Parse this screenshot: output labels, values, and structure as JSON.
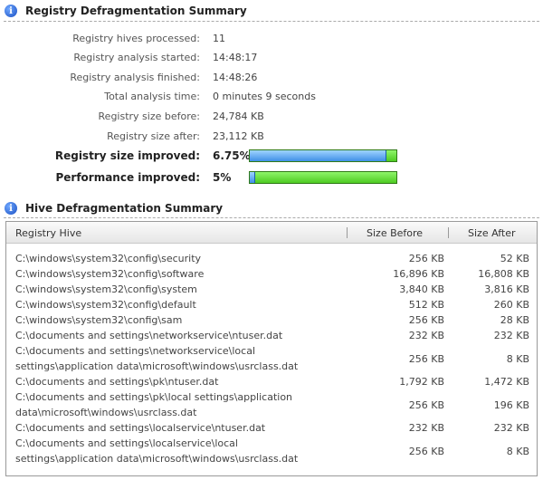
{
  "defrag_summary": {
    "title": "Registry Defragmentation Summary",
    "rows": [
      {
        "label": "Registry hives processed:",
        "value": "11"
      },
      {
        "label": "Registry analysis started:",
        "value": "14:48:17"
      },
      {
        "label": "Registry analysis finished:",
        "value": "14:48:26"
      },
      {
        "label": "Total analysis time:",
        "value": "0 minutes 9 seconds"
      },
      {
        "label": "Registry size before:",
        "value": "24,784 KB"
      },
      {
        "label": "Registry size after:",
        "value": "23,112 KB"
      }
    ],
    "size_improved": {
      "label": "Registry size improved:",
      "value": "6.75%",
      "bar_fraction": 0.93
    },
    "performance_improved": {
      "label": "Performance improved:",
      "value": "5%",
      "bar_fraction": 0.04
    },
    "colors": {
      "bar_blue": "#3f8fe6",
      "bar_green": "#4ecb22"
    }
  },
  "hive_summary": {
    "title": "Hive Defragmentation Summary",
    "columns": {
      "hive": "Registry Hive",
      "before": "Size Before",
      "after": "Size After"
    },
    "rows": [
      {
        "hive": "C:\\windows\\system32\\config\\security",
        "before": "256 KB",
        "after": "52 KB"
      },
      {
        "hive": "C:\\windows\\system32\\config\\software",
        "before": "16,896 KB",
        "after": "16,808 KB"
      },
      {
        "hive": "C:\\windows\\system32\\config\\system",
        "before": "3,840 KB",
        "after": "3,816 KB"
      },
      {
        "hive": "C:\\windows\\system32\\config\\default",
        "before": "512 KB",
        "after": "260 KB"
      },
      {
        "hive": "C:\\windows\\system32\\config\\sam",
        "before": "256 KB",
        "after": "28 KB"
      },
      {
        "hive": "C:\\documents and settings\\networkservice\\ntuser.dat",
        "before": "232 KB",
        "after": "232 KB"
      },
      {
        "hive": "C:\\documents and settings\\networkservice\\local settings\\application data\\microsoft\\windows\\usrclass.dat",
        "before": "256 KB",
        "after": "8 KB"
      },
      {
        "hive": "C:\\documents and settings\\pk\\ntuser.dat",
        "before": "1,792 KB",
        "after": "1,472 KB"
      },
      {
        "hive": "C:\\documents and settings\\pk\\local settings\\application data\\microsoft\\windows\\usrclass.dat",
        "before": "256 KB",
        "after": "196 KB"
      },
      {
        "hive": "C:\\documents and settings\\localservice\\ntuser.dat",
        "before": "232 KB",
        "after": "232 KB"
      },
      {
        "hive": "C:\\documents and settings\\localservice\\local settings\\application data\\microsoft\\windows\\usrclass.dat",
        "before": "256 KB",
        "after": "8 KB"
      }
    ]
  },
  "icons": {
    "section_icon": "info-icon"
  }
}
